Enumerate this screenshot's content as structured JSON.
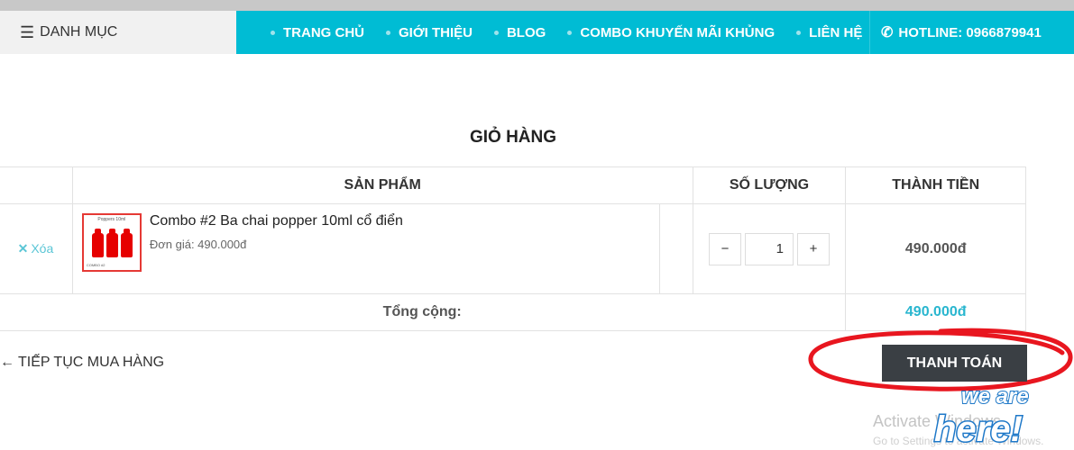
{
  "header": {
    "category_label": "DANH MỤC",
    "nav": [
      "TRANG CHỦ",
      "GIỚI THIỆU",
      "BLOG",
      "COMBO KHUYẾN MÃI KHỦNG",
      "LIÊN HỆ"
    ],
    "hotline": "HOTLINE: 0966879941"
  },
  "cart": {
    "title": "GIỎ HÀNG",
    "columns": {
      "product": "SẢN PHẨM",
      "quantity": "SỐ LƯỢNG",
      "subtotal": "THÀNH TIỀN"
    },
    "items": [
      {
        "remove_label": "Xóa",
        "thumb_top": "Poppers 10ml",
        "thumb_bottom": "COMBO #2",
        "name": "Combo #2 Ba chai popper 10ml cổ điển",
        "unit_price": "Đơn giá: 490.000đ",
        "quantity": "1",
        "subtotal": "490.000đ"
      }
    ],
    "total_label": "Tổng cộng:",
    "total_value": "490.000đ",
    "continue_label": "TIẾP TỤC MUA HÀNG",
    "checkout_label": "THANH TOÁN"
  },
  "overlay": {
    "activate_windows": "Activate Windows",
    "activate_hint": "Go to Settings to activate Windows.",
    "sticker_text_1": "we are",
    "sticker_text_2": "here!"
  },
  "colors": {
    "nav_bg": "#00bcd4",
    "accent": "#29b6cf",
    "checkout_bg": "#3a3f44",
    "annotation_red": "#e8161f"
  }
}
